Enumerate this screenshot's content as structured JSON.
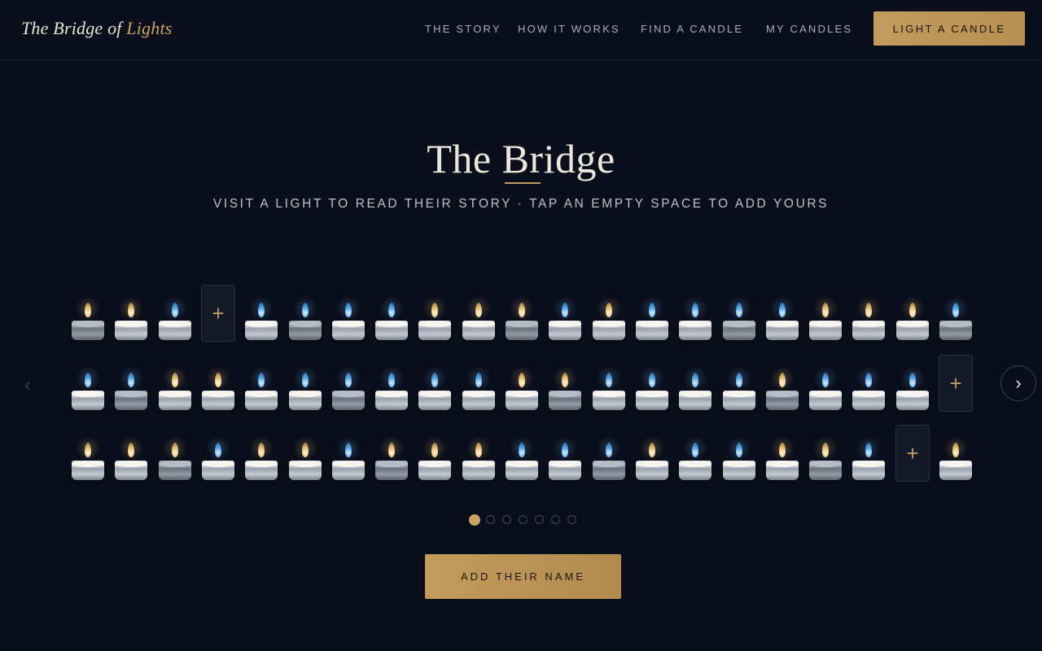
{
  "brand": {
    "logo_main": "The Bridge of",
    "logo_accent": "Lights"
  },
  "nav": {
    "items": [
      "THE STORY",
      "HOW IT WORKS",
      "FIND A CANDLE",
      "MY CANDLES"
    ],
    "cta": "LIGHT A CANDLE"
  },
  "hero": {
    "title": "The Bridge",
    "subtitle": "VISIT A LIGHT TO READ THEIR STORY · TAP AN EMPTY SPACE TO ADD YOURS"
  },
  "bridge": {
    "rows": [
      [
        "gold",
        "gold",
        "blue",
        "empty",
        "blue",
        "blue",
        "blue",
        "blue",
        "gold",
        "gold",
        "gold",
        "blue",
        "gold",
        "blue",
        "blue",
        "blue",
        "blue",
        "gold",
        "gold",
        "gold",
        "blue"
      ],
      [
        "blue",
        "blue",
        "gold",
        "gold",
        "blue",
        "blue",
        "blue",
        "blue",
        "blue",
        "blue",
        "gold",
        "gold",
        "blue",
        "blue",
        "blue",
        "blue",
        "gold",
        "blue",
        "blue",
        "blue",
        "empty"
      ],
      [
        "gold",
        "gold",
        "gold",
        "blue",
        "gold",
        "gold",
        "blue",
        "gold",
        "gold",
        "gold",
        "blue",
        "blue",
        "blue",
        "gold",
        "blue",
        "blue",
        "gold",
        "gold",
        "blue",
        "empty",
        "gold"
      ]
    ],
    "empty_symbol": "+",
    "nav_prev": "‹",
    "nav_next": "›"
  },
  "pagination": {
    "count": 7,
    "active": 0
  },
  "primary_action": "ADD THEIR NAME",
  "colors": {
    "background": "#0b0f1c",
    "accent_gold": "#c29c5c",
    "flame_gold": "#e7c27a",
    "flame_blue": "#5aa8e6"
  }
}
